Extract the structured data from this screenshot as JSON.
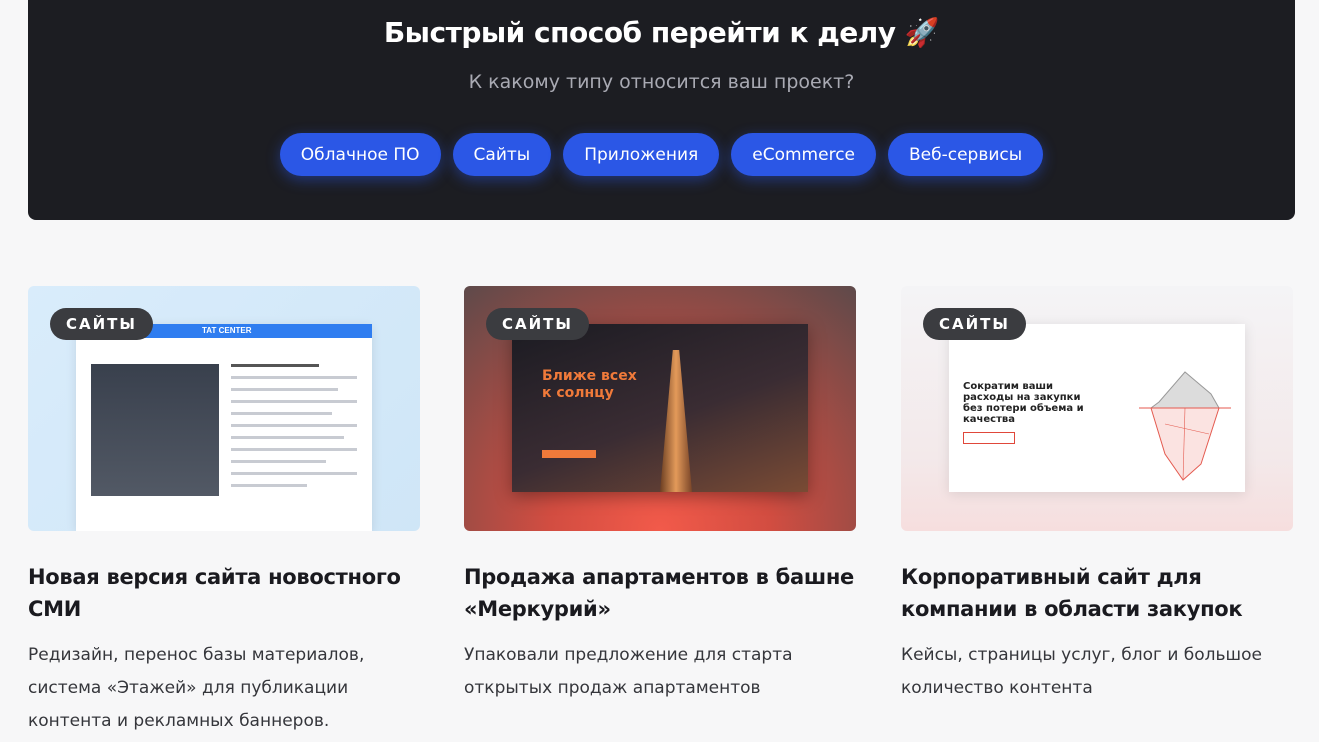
{
  "hero": {
    "title": "Быстрый способ перейти к делу 🚀",
    "subtitle": "К какому типу относится ваш проект?",
    "categories": [
      "Облачное ПО",
      "Сайты",
      "Приложения",
      "eCommerce",
      "Веб-сервисы"
    ]
  },
  "cases": [
    {
      "badge": "САЙТЫ",
      "title": "Новая версия сайта новостного СМИ",
      "description": "Редизайн, перенос базы материалов, система «Этажей» для публикации контента и рекламных баннеров.",
      "thumb_text": "TAT CENTER"
    },
    {
      "badge": "САЙТЫ",
      "title": "Продажа апартаментов в башне «Меркурий»",
      "description": "Упаковали предложение для старта открытых продаж апартаментов",
      "thumb_text": "Ближе всех к солнцу"
    },
    {
      "badge": "САЙТЫ",
      "title": "Корпоративный сайт для компании в области закупок",
      "description": "Кейсы, страницы услуг, блог и большое количество контента",
      "thumb_text": "Сократим ваши расходы на закупки без потери объема и качества"
    }
  ],
  "colors": {
    "accent": "#2b57e6",
    "hero_bg": "#1c1d22",
    "badge_bg": "#3b3c40"
  }
}
